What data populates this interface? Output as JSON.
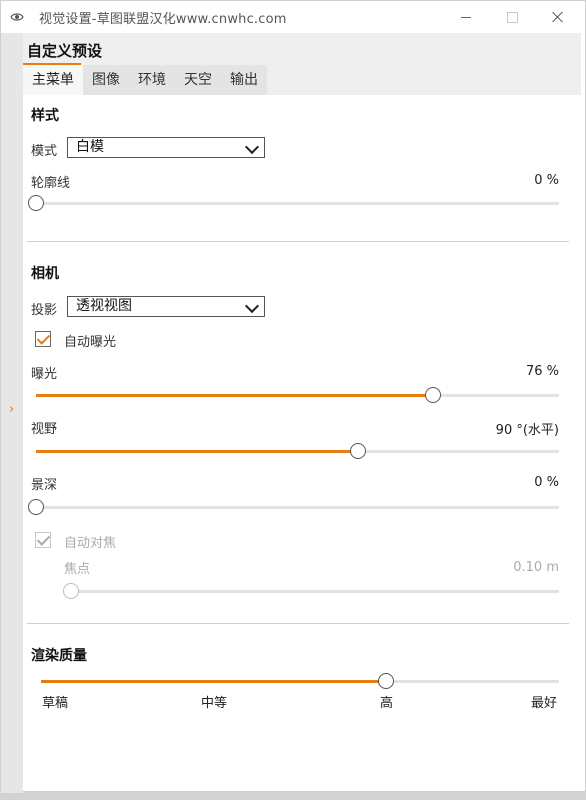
{
  "window": {
    "title": "视觉设置-草图联盟汉化www.cnwhc.com"
  },
  "panel": {
    "title": "自定义预设",
    "tabs": [
      "主菜单",
      "图像",
      "环境",
      "天空",
      "输出"
    ],
    "active_tab": 0
  },
  "style_section": {
    "title": "样式",
    "mode_label": "模式",
    "mode_value": "白模",
    "outline_label": "轮廓线",
    "outline_value": "0 %",
    "outline_fraction": 0
  },
  "camera_section": {
    "title": "相机",
    "projection_label": "投影",
    "projection_value": "透视视图",
    "auto_exposure_label": "自动曝光",
    "auto_exposure_checked": true,
    "exposure_label": "曝光",
    "exposure_value": "76 %",
    "exposure_fraction": 0.76,
    "fov_label": "视野",
    "fov_value": "90 °(水平)",
    "fov_fraction": 0.615,
    "dof_label": "景深",
    "dof_value": "0 %",
    "dof_fraction": 0,
    "autofocus_label": "自动对焦",
    "autofocus_checked": true,
    "focus_label": "焦点",
    "focus_value": "0.10 m",
    "focus_fraction": 0
  },
  "render_quality": {
    "title": "渲染质量",
    "levels": [
      "草稿",
      "中等",
      "高",
      "最好"
    ],
    "fraction": 0.666
  },
  "colors": {
    "accent": "#e87c10"
  },
  "icons": {
    "app": "eye-icon",
    "expand": "chevron-right-icon"
  }
}
